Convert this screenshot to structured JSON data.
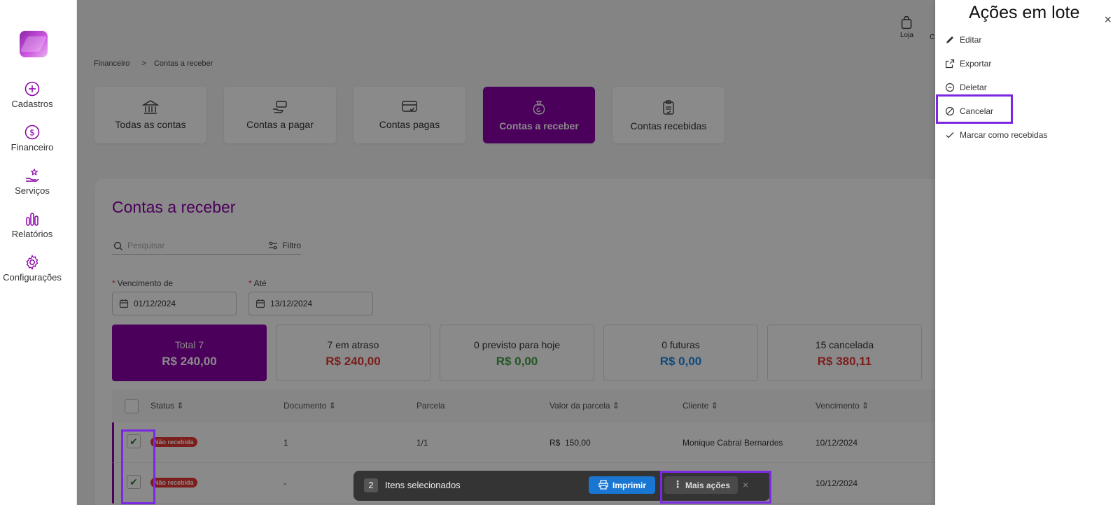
{
  "sidebar": {
    "items": [
      {
        "label": "Cadastros",
        "icon": "plus-circle-icon"
      },
      {
        "label": "Financeiro",
        "icon": "dollar-circle-icon"
      },
      {
        "label": "Serviços",
        "icon": "hand-star-icon"
      },
      {
        "label": "Relatórios",
        "icon": "bar-chart-icon"
      },
      {
        "label": "Configurações",
        "icon": "gear-icon"
      }
    ]
  },
  "topbar": {
    "store_label": "Loja",
    "truncated_label": "C"
  },
  "breadcrumb": {
    "root": "Financeiro",
    "separator": ">",
    "current": "Contas a receber"
  },
  "tiles": [
    {
      "label": "Todas as contas",
      "icon": "bank-icon"
    },
    {
      "label": "Contas a pagar",
      "icon": "hand-money-icon"
    },
    {
      "label": "Contas pagas",
      "icon": "card-check-icon"
    },
    {
      "label": "Contas a receber",
      "icon": "money-bag-icon",
      "active": true
    },
    {
      "label": "Contas recebidas",
      "icon": "clipboard-check-icon"
    }
  ],
  "panel": {
    "title": "Contas a receber",
    "search_placeholder": "Pesquisar",
    "filter_label": "Filtro",
    "date_from_label": "Vencimento de",
    "date_from_value": "01/12/2024",
    "date_to_label": "Até",
    "date_to_value": "13/12/2024"
  },
  "stats": [
    {
      "label": "Total 7",
      "value": "R$ 240,00",
      "color": "#ffffff",
      "active": true
    },
    {
      "label": "7 em atraso",
      "value": "R$ 240,00",
      "color": "#e53935"
    },
    {
      "label": "0 previsto para hoje",
      "value": "R$ 0,00",
      "color": "#43a047"
    },
    {
      "label": "0 futuras",
      "value": "R$ 0,00",
      "color": "#1e88e5"
    },
    {
      "label": "15 cancelada",
      "value": "R$ 380,11",
      "color": "#e53935"
    }
  ],
  "table": {
    "columns": [
      "Status",
      "Documento",
      "Parcela",
      "Valor da parcela",
      "Cliente",
      "Vencimento"
    ],
    "rows": [
      {
        "status": "Não recebida",
        "documento": "1",
        "parcela": "1/1",
        "valor": "R$  150,00",
        "cliente": "Monique Cabral Bernardes",
        "vencimento": "10/12/2024",
        "checked": true
      },
      {
        "status": "Não recebida",
        "documento": "-",
        "parcela": "",
        "valor": "",
        "cliente": "",
        "vencimento": "10/12/2024",
        "checked": true
      }
    ]
  },
  "selection_bar": {
    "count": "2",
    "label": "Itens selecionados",
    "print_label": "Imprimir",
    "more_label": "Mais ações",
    "close": "×"
  },
  "drawer": {
    "title": "Ações em lote",
    "close": "×",
    "actions": [
      {
        "label": "Editar",
        "icon": "pencil-icon"
      },
      {
        "label": "Exportar",
        "icon": "export-icon"
      },
      {
        "label": "Deletar",
        "icon": "minus-circle-icon"
      },
      {
        "label": "Cancelar",
        "icon": "cancel-circle-icon"
      },
      {
        "label": "Marcar como recebidas",
        "icon": "check-icon"
      }
    ]
  },
  "colors": {
    "brand": "#8b00a8",
    "highlight": "#7b28e3",
    "print_button": "#1976d2"
  }
}
